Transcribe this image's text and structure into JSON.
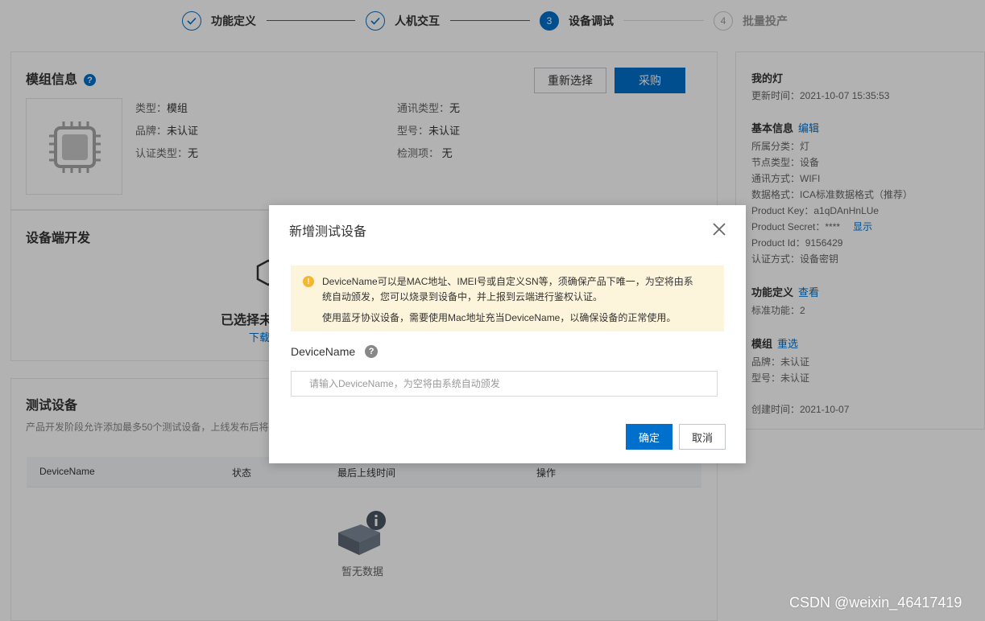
{
  "stepper": {
    "steps": [
      {
        "num": "",
        "label": "功能定义",
        "state": "done"
      },
      {
        "num": "",
        "label": "人机交互",
        "state": "done"
      },
      {
        "num": "3",
        "label": "设备调试",
        "state": "active"
      },
      {
        "num": "4",
        "label": "批量投产",
        "state": "todo"
      }
    ]
  },
  "module_info": {
    "title": "模组信息",
    "help_icon": "question-icon",
    "reselect_label": "重新选择",
    "purchase_label": "采购",
    "fields": [
      {
        "label": "类型：",
        "value": "模组"
      },
      {
        "label": "通讯类型：",
        "value": "无"
      },
      {
        "label": "品牌：",
        "value": "未认证"
      },
      {
        "label": "型号：",
        "value": "未认证"
      },
      {
        "label": "认证类型：",
        "value": "无"
      },
      {
        "label": "检测项：",
        "value": " 无"
      }
    ]
  },
  "device_dev": {
    "title": "设备端开发",
    "selected_text": "已选择未",
    "download_text": "下载"
  },
  "test_devices": {
    "title": "测试设备",
    "note": "产品开发阶段允许添加最多50个测试设备，上线发布后将",
    "columns": [
      "DeviceName",
      "状态",
      "最后上线时间",
      "操作"
    ],
    "empty_text": "暂无数据"
  },
  "sidebar": {
    "product_name": "我的灯",
    "updated": "更新时间：2021-10-07 15:35:53",
    "basic_title": "基本信息",
    "edit_link": "编辑",
    "basic_rows": [
      "所属分类：灯",
      "节点类型：设备",
      "通讯方式：WIFI",
      "数据格式：ICA标准数据格式（推荐）",
      "Product Key：a1qDAnHnLUe"
    ],
    "secret_label": "Product Secret：****",
    "secret_show": "显示",
    "product_id": "Product Id：9156429",
    "auth_method": "认证方式：设备密钥",
    "feature_title": "功能定义",
    "feature_link": "查看",
    "feature_row": "标准功能：2",
    "module_title": "模组",
    "module_link": "重选",
    "module_rows": [
      "品牌：未认证",
      "型号：未认证"
    ],
    "created": "创建时间：2021-10-07"
  },
  "modal": {
    "title": "新增测试设备",
    "notice_line1": "DeviceName可以是MAC地址、IMEI号或自定义SN等，须确保产品下唯一，为空将由系",
    "notice_line2": "统自动颁发，您可以烧录到设备中，并上报到云端进行鉴权认证。",
    "notice_line3": "使用蓝牙协议设备，需要使用Mac地址充当DeviceName，以确保设备的正常使用。",
    "field_label": "DeviceName",
    "input_placeholder": "请输入DeviceName，为空将由系统自动颁发",
    "input_value": "",
    "confirm_label": "确定",
    "cancel_label": "取消"
  },
  "watermark": "CSDN @weixin_46417419",
  "colors": {
    "primary": "#0070cc",
    "notice_bg": "#fdf5db",
    "warn": "#f5b72e"
  }
}
